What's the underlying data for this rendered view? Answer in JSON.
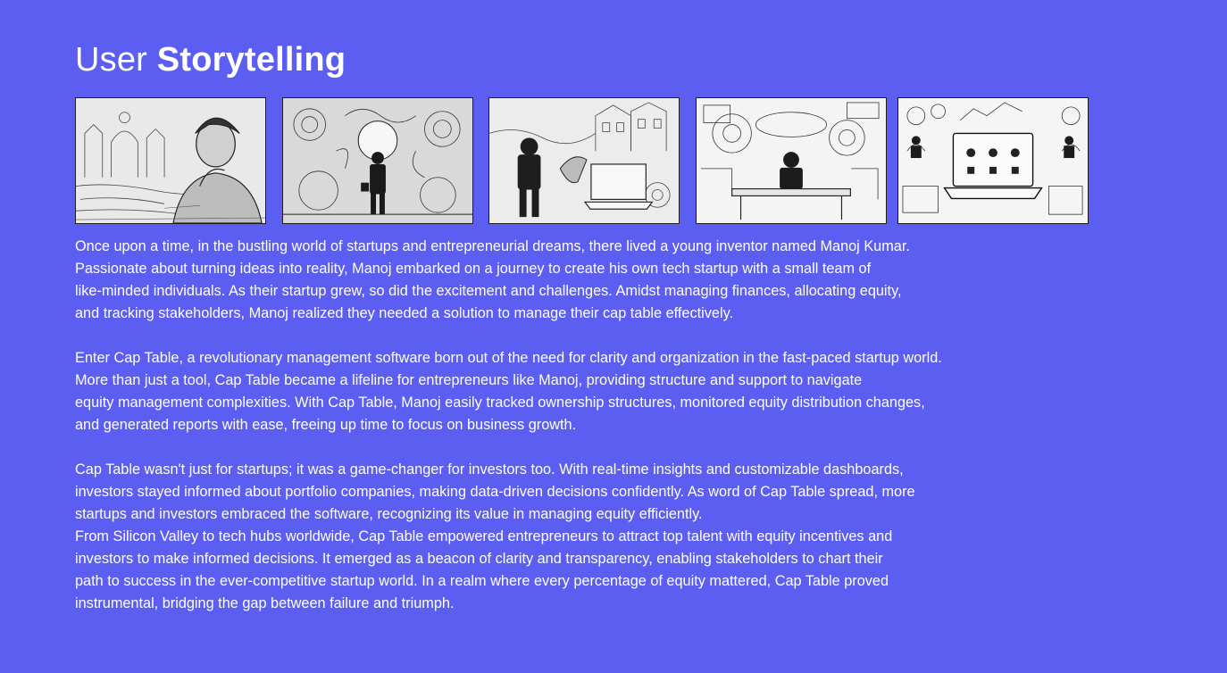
{
  "header": {
    "title_light": "User",
    "title_bold": "Storytelling"
  },
  "gallery": {
    "images": [
      {
        "icon": "inventor-sketch-image"
      },
      {
        "icon": "ideas-journey-image"
      },
      {
        "icon": "startup-team-image"
      },
      {
        "icon": "cap-table-management-image"
      },
      {
        "icon": "equity-dashboard-image"
      }
    ]
  },
  "story": {
    "paragraph_1": [
      "Once upon a time, in the bustling world of startups and entrepreneurial dreams, there lived a young inventor named Manoj Kumar.",
      "Passionate about turning ideas into reality, Manoj embarked on a journey to create his own tech startup with a small team of",
      "like-minded individuals. As their startup grew, so did the excitement and challenges. Amidst managing finances, allocating equity,",
      "and tracking stakeholders, Manoj realized they needed a solution to manage their cap table effectively."
    ],
    "paragraph_2": [
      "Enter Cap Table, a revolutionary management software born out of the need for clarity and organization in the fast-paced startup world.",
      "More than just a tool, Cap Table became a lifeline for entrepreneurs like Manoj, providing structure and support to navigate",
      "equity management complexities. With Cap Table, Manoj easily tracked ownership structures, monitored equity distribution changes,",
      "and generated reports with ease, freeing up time to focus on business growth."
    ],
    "paragraph_3": [
      "Cap Table wasn't just for startups; it was a game-changer for investors too. With real-time insights and customizable dashboards,",
      "investors stayed informed about portfolio companies, making data-driven decisions confidently. As word of Cap Table spread, more",
      "startups and investors embraced the software, recognizing its value in managing equity efficiently."
    ],
    "paragraph_4": [
      "From Silicon Valley to tech hubs worldwide, Cap Table empowered entrepreneurs to attract top talent with equity incentives and",
      "investors to make informed decisions. It emerged as a beacon of clarity and transparency, enabling stakeholders to chart their",
      "path to success in the ever-competitive startup world. In a realm where every percentage of equity mattered, Cap Table proved",
      "instrumental, bridging the gap between failure and triumph."
    ]
  }
}
